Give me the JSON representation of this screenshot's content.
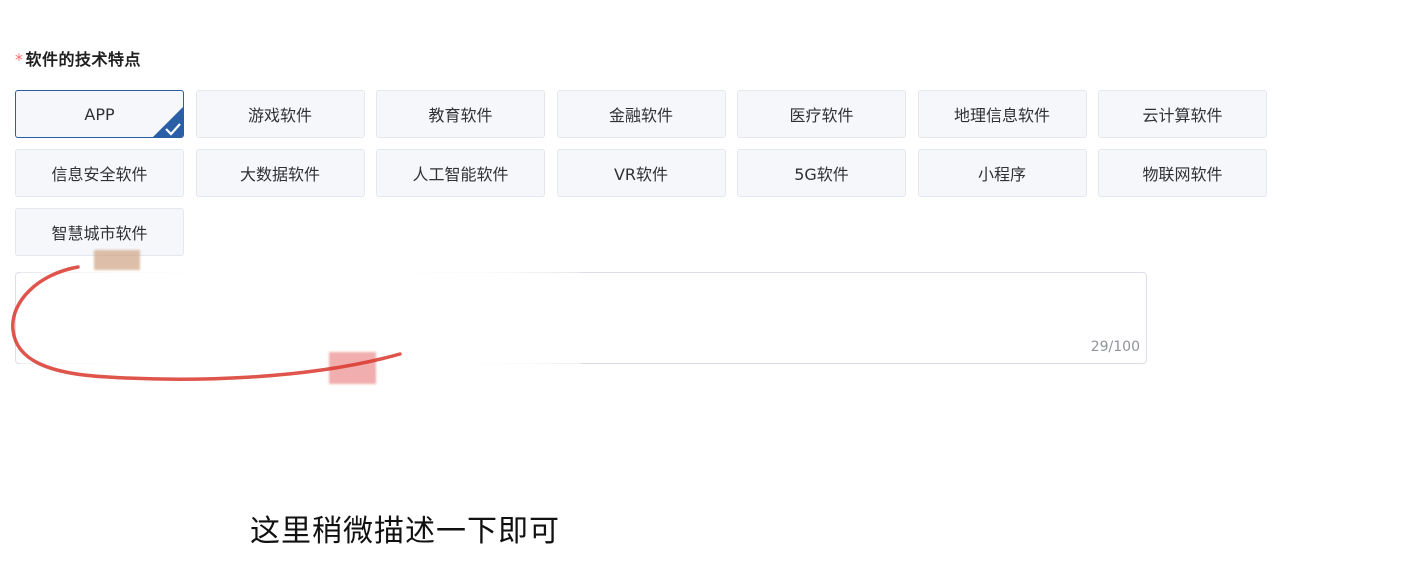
{
  "form": {
    "required_mark": "*",
    "label": "软件的技术特点",
    "tags": [
      {
        "label": "APP",
        "selected": true
      },
      {
        "label": "游戏软件",
        "selected": false
      },
      {
        "label": "教育软件",
        "selected": false
      },
      {
        "label": "金融软件",
        "selected": false
      },
      {
        "label": "医疗软件",
        "selected": false
      },
      {
        "label": "地理信息软件",
        "selected": false
      },
      {
        "label": "云计算软件",
        "selected": false
      },
      {
        "label": "信息安全软件",
        "selected": false
      },
      {
        "label": "大数据软件",
        "selected": false
      },
      {
        "label": "人工智能软件",
        "selected": false
      },
      {
        "label": "VR软件",
        "selected": false
      },
      {
        "label": "5G软件",
        "selected": false
      },
      {
        "label": "小程序",
        "selected": false
      },
      {
        "label": "物联网软件",
        "selected": false
      },
      {
        "label": "智慧城市软件",
        "selected": false
      }
    ],
    "textarea": {
      "counter": "29/100"
    }
  },
  "annotation": {
    "caption": "这里稍微描述一下即可",
    "circle_color": "#d9362b"
  },
  "colors": {
    "required": "#f56c6c",
    "selected_border": "#2a5fa8",
    "tag_bg": "#f5f7fa"
  }
}
